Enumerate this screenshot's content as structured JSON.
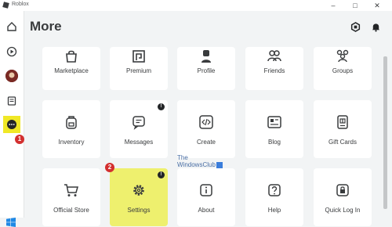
{
  "window": {
    "title": "Roblox",
    "minimize": "–",
    "maximize": "□",
    "close": "✕"
  },
  "page": {
    "title": "More"
  },
  "tiles": [
    {
      "label": "Marketplace",
      "icon": "bag-icon"
    },
    {
      "label": "Premium",
      "icon": "premium-icon"
    },
    {
      "label": "Profile",
      "icon": "person-icon"
    },
    {
      "label": "Friends",
      "icon": "friends-icon"
    },
    {
      "label": "Groups",
      "icon": "groups-icon"
    },
    {
      "label": "Inventory",
      "icon": "backpack-icon"
    },
    {
      "label": "Messages",
      "icon": "message-icon",
      "badge": "!"
    },
    {
      "label": "Create",
      "icon": "code-icon"
    },
    {
      "label": "Blog",
      "icon": "blog-icon"
    },
    {
      "label": "Gift Cards",
      "icon": "gift-card-icon"
    },
    {
      "label": "Official Store",
      "icon": "cart-icon"
    },
    {
      "label": "Settings",
      "icon": "gear-icon",
      "badge": "!"
    },
    {
      "label": "About",
      "icon": "info-icon"
    },
    {
      "label": "Help",
      "icon": "help-icon"
    },
    {
      "label": "Quick Log In",
      "icon": "lock-icon"
    }
  ],
  "callouts": {
    "one": "1",
    "two": "2"
  },
  "watermark": {
    "line1": "The",
    "line2": "WindowsClub"
  },
  "colors": {
    "highlight": "#eef06e",
    "active_nav": "#f0e826",
    "callout": "#d32f2f"
  }
}
